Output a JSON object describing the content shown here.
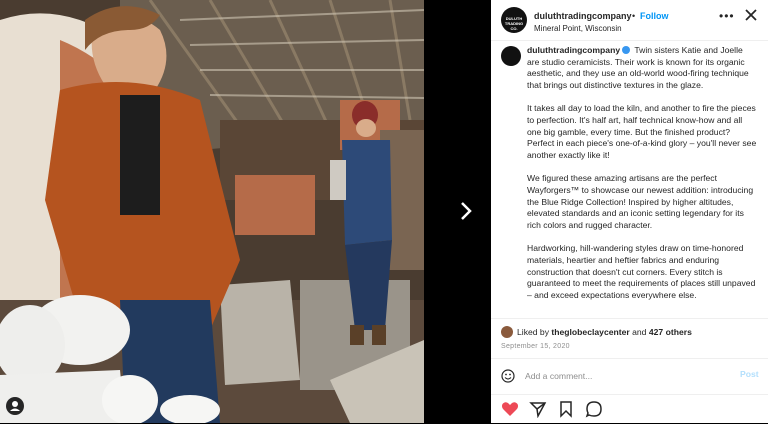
{
  "post": {
    "username": "duluthtradingcompany",
    "separator": "•",
    "follow_label": "Follow",
    "location": "Mineral Point, Wisconsin",
    "logo_text": "DULUTH TRADING CO.",
    "more_icon": "more-icon",
    "close_icon": "close-icon",
    "next_icon": "chevron-right-icon",
    "user_icon": "user-tag-icon"
  },
  "caption": {
    "username": "duluthtradingcompany",
    "paragraphs": [
      "Twin sisters Katie and Joelle are studio ceramicists. Their work is known for its organic aesthetic, and they use an old-world wood-firing technique that brings out distinctive textures in the glaze.",
      "It takes all day to load the kiln, and another to fire the pieces to perfection. It's half art, half technical know-how and all one big gamble, every time. But the finished product? Perfect in each piece's one-of-a-kind glory – you'll never see another exactly like it!",
      "We figured these amazing artisans are the perfect Wayforgers™ to showcase our newest addition: introducing the Blue Ridge Collection! Inspired by higher altitudes, elevated standards and an iconic setting legendary for its rich colors and rugged character.",
      "Hardworking, hill-wandering styles draw on time-honored materials, heartier and heftier fabrics and enduring construction that doesn't cut corners. Every stitch is guaranteed to meet the requirements of places still unpaved – and exceed expectations everywhere else."
    ]
  },
  "likes": {
    "prefix": "Liked by",
    "user": "theglobeclaycenter",
    "conjunction": "and",
    "others": "427 others"
  },
  "date": "September 15, 2020",
  "comment": {
    "placeholder": "Add a comment...",
    "post_label": "Post"
  },
  "colors": {
    "heart": "#ed4956",
    "link": "#0095f6",
    "text": "#262626",
    "muted": "#8e8e8e"
  }
}
